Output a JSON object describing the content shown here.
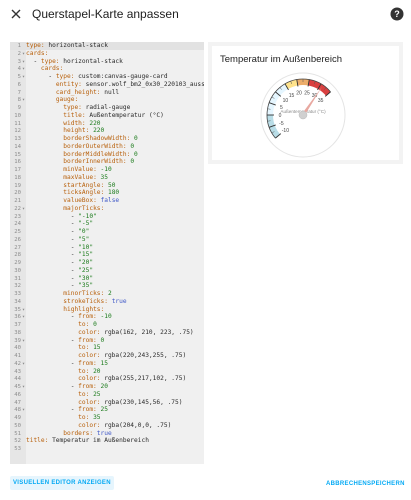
{
  "dialog": {
    "title": "Querstapel-Karte anpassen",
    "close_icon": "close-icon",
    "help_icon": "help-circle-icon"
  },
  "editor": {
    "lines": [
      {
        "n": "1",
        "fold": "",
        "segs": [
          [
            "k",
            "type: "
          ],
          [
            "v",
            "horizontal-stack"
          ]
        ]
      },
      {
        "n": "2",
        "fold": "▾",
        "segs": [
          [
            "k",
            "cards:"
          ]
        ]
      },
      {
        "n": "3",
        "fold": "▾",
        "segs": [
          [
            "v",
            "  "
          ],
          [
            "dash",
            "- "
          ],
          [
            "k",
            "type: "
          ],
          [
            "v",
            "horizontal-stack"
          ]
        ]
      },
      {
        "n": "4",
        "fold": "▾",
        "segs": [
          [
            "v",
            "    "
          ],
          [
            "k",
            "cards:"
          ]
        ]
      },
      {
        "n": "5",
        "fold": "▾",
        "segs": [
          [
            "v",
            "      "
          ],
          [
            "dash",
            "- "
          ],
          [
            "k",
            "type: "
          ],
          [
            "v",
            "custom:canvas-gauge-card"
          ]
        ]
      },
      {
        "n": "6",
        "fold": "",
        "segs": [
          [
            "v",
            "        "
          ],
          [
            "k",
            "entity: "
          ],
          [
            "v",
            "sensor.wolf_bm2_0x30_220103_aussen"
          ]
        ]
      },
      {
        "n": "7",
        "fold": "",
        "segs": [
          [
            "v",
            "        "
          ],
          [
            "k",
            "card_height: "
          ],
          [
            "v",
            "null"
          ]
        ]
      },
      {
        "n": "8",
        "fold": "▾",
        "segs": [
          [
            "v",
            "        "
          ],
          [
            "k",
            "gauge:"
          ]
        ]
      },
      {
        "n": "9",
        "fold": "",
        "segs": [
          [
            "v",
            "          "
          ],
          [
            "k",
            "type: "
          ],
          [
            "v",
            "radial-gauge"
          ]
        ]
      },
      {
        "n": "10",
        "fold": "",
        "segs": [
          [
            "v",
            "          "
          ],
          [
            "k",
            "title: "
          ],
          [
            "v",
            "Außentemperatur (°C)"
          ]
        ]
      },
      {
        "n": "11",
        "fold": "",
        "segs": [
          [
            "v",
            "          "
          ],
          [
            "k",
            "width: "
          ],
          [
            "n",
            "220"
          ]
        ]
      },
      {
        "n": "12",
        "fold": "",
        "segs": [
          [
            "v",
            "          "
          ],
          [
            "k",
            "height: "
          ],
          [
            "n",
            "220"
          ]
        ]
      },
      {
        "n": "13",
        "fold": "",
        "segs": [
          [
            "v",
            "          "
          ],
          [
            "k",
            "borderShadowWidth: "
          ],
          [
            "n",
            "0"
          ]
        ]
      },
      {
        "n": "14",
        "fold": "",
        "segs": [
          [
            "v",
            "          "
          ],
          [
            "k",
            "borderOuterWidth: "
          ],
          [
            "n",
            "0"
          ]
        ]
      },
      {
        "n": "15",
        "fold": "",
        "segs": [
          [
            "v",
            "          "
          ],
          [
            "k",
            "borderMiddleWidth: "
          ],
          [
            "n",
            "0"
          ]
        ]
      },
      {
        "n": "16",
        "fold": "",
        "segs": [
          [
            "v",
            "          "
          ],
          [
            "k",
            "borderInnerWidth: "
          ],
          [
            "n",
            "0"
          ]
        ]
      },
      {
        "n": "17",
        "fold": "",
        "segs": [
          [
            "v",
            "          "
          ],
          [
            "k",
            "minValue: "
          ],
          [
            "n",
            "-10"
          ]
        ]
      },
      {
        "n": "18",
        "fold": "",
        "segs": [
          [
            "v",
            "          "
          ],
          [
            "k",
            "maxValue: "
          ],
          [
            "n",
            "35"
          ]
        ]
      },
      {
        "n": "19",
        "fold": "",
        "segs": [
          [
            "v",
            "          "
          ],
          [
            "k",
            "startAngle: "
          ],
          [
            "n",
            "50"
          ]
        ]
      },
      {
        "n": "20",
        "fold": "",
        "segs": [
          [
            "v",
            "          "
          ],
          [
            "k",
            "ticksAngle: "
          ],
          [
            "n",
            "180"
          ]
        ]
      },
      {
        "n": "21",
        "fold": "",
        "segs": [
          [
            "v",
            "          "
          ],
          [
            "k",
            "valueBox: "
          ],
          [
            "b",
            "false"
          ]
        ]
      },
      {
        "n": "22",
        "fold": "▾",
        "segs": [
          [
            "v",
            "          "
          ],
          [
            "k",
            "majorTicks:"
          ]
        ]
      },
      {
        "n": "23",
        "fold": "",
        "segs": [
          [
            "v",
            "            "
          ],
          [
            "dash",
            "- "
          ],
          [
            "s",
            "\"-10\""
          ]
        ]
      },
      {
        "n": "24",
        "fold": "",
        "segs": [
          [
            "v",
            "            "
          ],
          [
            "dash",
            "- "
          ],
          [
            "s",
            "\"-5\""
          ]
        ]
      },
      {
        "n": "25",
        "fold": "",
        "segs": [
          [
            "v",
            "            "
          ],
          [
            "dash",
            "- "
          ],
          [
            "s",
            "\"0\""
          ]
        ]
      },
      {
        "n": "26",
        "fold": "",
        "segs": [
          [
            "v",
            "            "
          ],
          [
            "dash",
            "- "
          ],
          [
            "s",
            "\"5\""
          ]
        ]
      },
      {
        "n": "27",
        "fold": "",
        "segs": [
          [
            "v",
            "            "
          ],
          [
            "dash",
            "- "
          ],
          [
            "s",
            "\"10\""
          ]
        ]
      },
      {
        "n": "28",
        "fold": "",
        "segs": [
          [
            "v",
            "            "
          ],
          [
            "dash",
            "- "
          ],
          [
            "s",
            "\"15\""
          ]
        ]
      },
      {
        "n": "29",
        "fold": "",
        "segs": [
          [
            "v",
            "            "
          ],
          [
            "dash",
            "- "
          ],
          [
            "s",
            "\"20\""
          ]
        ]
      },
      {
        "n": "30",
        "fold": "",
        "segs": [
          [
            "v",
            "            "
          ],
          [
            "dash",
            "- "
          ],
          [
            "s",
            "\"25\""
          ]
        ]
      },
      {
        "n": "31",
        "fold": "",
        "segs": [
          [
            "v",
            "            "
          ],
          [
            "dash",
            "- "
          ],
          [
            "s",
            "\"30\""
          ]
        ]
      },
      {
        "n": "32",
        "fold": "",
        "segs": [
          [
            "v",
            "            "
          ],
          [
            "dash",
            "- "
          ],
          [
            "s",
            "\"35\""
          ]
        ]
      },
      {
        "n": "33",
        "fold": "",
        "segs": [
          [
            "v",
            "          "
          ],
          [
            "k",
            "minorTicks: "
          ],
          [
            "n",
            "2"
          ]
        ]
      },
      {
        "n": "34",
        "fold": "",
        "segs": [
          [
            "v",
            "          "
          ],
          [
            "k",
            "strokeTicks: "
          ],
          [
            "b",
            "true"
          ]
        ]
      },
      {
        "n": "35",
        "fold": "▾",
        "segs": [
          [
            "v",
            "          "
          ],
          [
            "k",
            "highlights:"
          ]
        ]
      },
      {
        "n": "36",
        "fold": "▾",
        "segs": [
          [
            "v",
            "            "
          ],
          [
            "dash",
            "- "
          ],
          [
            "k",
            "from: "
          ],
          [
            "n",
            "-10"
          ]
        ]
      },
      {
        "n": "37",
        "fold": "",
        "segs": [
          [
            "v",
            "              "
          ],
          [
            "k",
            "to: "
          ],
          [
            "n",
            "0"
          ]
        ]
      },
      {
        "n": "38",
        "fold": "",
        "segs": [
          [
            "v",
            "              "
          ],
          [
            "k",
            "color: "
          ],
          [
            "v",
            "rgba(162, 210, 223, .75)"
          ]
        ]
      },
      {
        "n": "39",
        "fold": "▾",
        "segs": [
          [
            "v",
            "            "
          ],
          [
            "dash",
            "- "
          ],
          [
            "k",
            "from: "
          ],
          [
            "n",
            "0"
          ]
        ]
      },
      {
        "n": "40",
        "fold": "",
        "segs": [
          [
            "v",
            "              "
          ],
          [
            "k",
            "to: "
          ],
          [
            "n",
            "15"
          ]
        ]
      },
      {
        "n": "41",
        "fold": "",
        "segs": [
          [
            "v",
            "              "
          ],
          [
            "k",
            "color: "
          ],
          [
            "v",
            "rgba(220,243,255, .75)"
          ]
        ]
      },
      {
        "n": "42",
        "fold": "▾",
        "segs": [
          [
            "v",
            "            "
          ],
          [
            "dash",
            "- "
          ],
          [
            "k",
            "from: "
          ],
          [
            "n",
            "15"
          ]
        ]
      },
      {
        "n": "43",
        "fold": "",
        "segs": [
          [
            "v",
            "              "
          ],
          [
            "k",
            "to: "
          ],
          [
            "n",
            "20"
          ]
        ]
      },
      {
        "n": "44",
        "fold": "",
        "segs": [
          [
            "v",
            "              "
          ],
          [
            "k",
            "color: "
          ],
          [
            "v",
            "rgba(255,217,102, .75)"
          ]
        ]
      },
      {
        "n": "45",
        "fold": "▾",
        "segs": [
          [
            "v",
            "            "
          ],
          [
            "dash",
            "- "
          ],
          [
            "k",
            "from: "
          ],
          [
            "n",
            "20"
          ]
        ]
      },
      {
        "n": "46",
        "fold": "",
        "segs": [
          [
            "v",
            "              "
          ],
          [
            "k",
            "to: "
          ],
          [
            "n",
            "25"
          ]
        ]
      },
      {
        "n": "47",
        "fold": "",
        "segs": [
          [
            "v",
            "              "
          ],
          [
            "k",
            "color: "
          ],
          [
            "v",
            "rgba(230,145,56, .75)"
          ]
        ]
      },
      {
        "n": "48",
        "fold": "▾",
        "segs": [
          [
            "v",
            "            "
          ],
          [
            "dash",
            "- "
          ],
          [
            "k",
            "from: "
          ],
          [
            "n",
            "25"
          ]
        ]
      },
      {
        "n": "49",
        "fold": "",
        "segs": [
          [
            "v",
            "              "
          ],
          [
            "k",
            "to: "
          ],
          [
            "n",
            "35"
          ]
        ]
      },
      {
        "n": "50",
        "fold": "",
        "segs": [
          [
            "v",
            "              "
          ],
          [
            "k",
            "color: "
          ],
          [
            "v",
            "rgba(204,0,0, .75)"
          ]
        ]
      },
      {
        "n": "51",
        "fold": "",
        "segs": [
          [
            "v",
            "          "
          ],
          [
            "k",
            "borders: "
          ],
          [
            "b",
            "true"
          ]
        ]
      },
      {
        "n": "52",
        "fold": "",
        "segs": [
          [
            "k",
            "title: "
          ],
          [
            "v",
            "Temperatur im Außenbereich"
          ]
        ]
      },
      {
        "n": "53",
        "fold": "",
        "segs": []
      }
    ]
  },
  "preview": {
    "card_title": "Temperatur im Außenbereich",
    "gauge": {
      "title": "Außentemperatur (°C)",
      "min": -10,
      "max": 35,
      "start_angle": 50,
      "ticks_angle": 180,
      "major_ticks": [
        "-10",
        "-5",
        "0",
        "5",
        "10",
        "15",
        "20",
        "25",
        "30",
        "35"
      ],
      "value": 31,
      "highlights": [
        {
          "from": -10,
          "to": 0,
          "color": "#a2d2df"
        },
        {
          "from": 0,
          "to": 15,
          "color": "#dcf3ff"
        },
        {
          "from": 15,
          "to": 20,
          "color": "#ffd966"
        },
        {
          "from": 20,
          "to": 25,
          "color": "#e69138"
        },
        {
          "from": 25,
          "to": 35,
          "color": "#cc0000"
        }
      ],
      "needle_color": "#e8a8a0"
    }
  },
  "footer": {
    "visual_editor": "VISUELLEN EDITOR ANZEIGEN",
    "cancel": "ABBRECHEN",
    "save": "SPEICHERN"
  },
  "colors": {
    "accent": "#03a9f4"
  }
}
